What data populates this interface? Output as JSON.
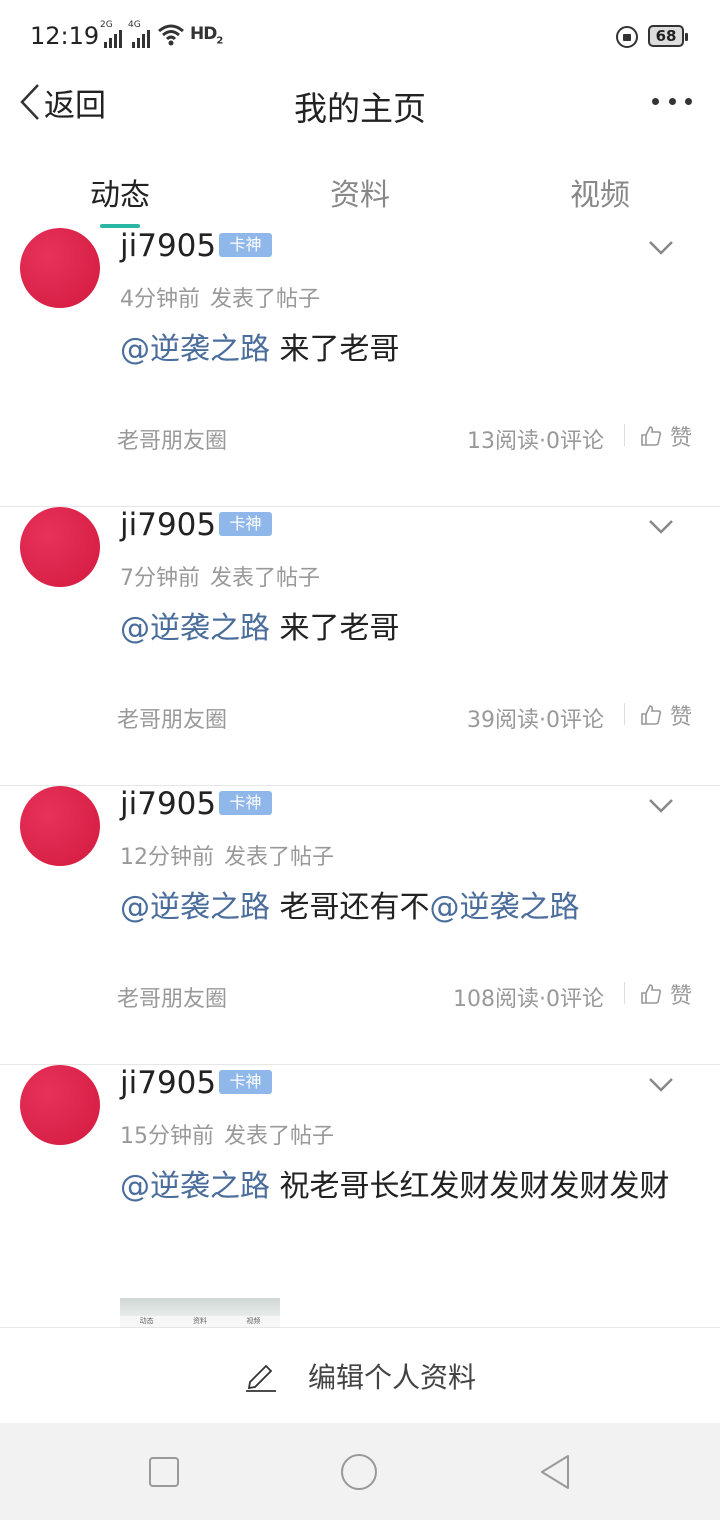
{
  "status": {
    "time": "12:19",
    "net1": "2G",
    "net2": "4G",
    "hd": "HD",
    "hd_sub": "2",
    "battery": "68"
  },
  "nav": {
    "back_label": "返回",
    "title": "我的主页"
  },
  "tabs": [
    {
      "label": "动态"
    },
    {
      "label": "资料"
    },
    {
      "label": "视频"
    }
  ],
  "posts": [
    {
      "user": "ji7905",
      "badge": "卡神",
      "time": "4分钟前",
      "action": "发表了帖子",
      "mention": "@逆袭之路",
      "text": " 来了老哥",
      "group": "老哥朋友圈",
      "stats": "13阅读·0评论",
      "like": "赞"
    },
    {
      "user": "ji7905",
      "badge": "卡神",
      "time": "7分钟前",
      "action": "发表了帖子",
      "mention": "@逆袭之路",
      "text": " 来了老哥",
      "group": "老哥朋友圈",
      "stats": "39阅读·0评论",
      "like": "赞"
    },
    {
      "user": "ji7905",
      "badge": "卡神",
      "time": "12分钟前",
      "action": "发表了帖子",
      "mention": "@逆袭之路",
      "text": " 老哥还有不",
      "mention2": "@逆袭之路",
      "group": "老哥朋友圈",
      "stats": "108阅读·0评论",
      "like": "赞"
    },
    {
      "user": "ji7905",
      "badge": "卡神",
      "time": "15分钟前",
      "action": "发表了帖子",
      "mention": "@逆袭之路",
      "text": " 祝老哥长红发财发财发财发财"
    }
  ],
  "thumbnail_tabs": [
    "动态",
    "资料",
    "视频"
  ],
  "edit_profile": "编辑个人资料",
  "colors": {
    "accent": "#2ab7a6",
    "avatar": "#dc2347",
    "badge": "#8fb7ea",
    "mention": "#4a6d9b"
  },
  "icons": {
    "back": "chevron-left-icon",
    "more": "more-dots-icon",
    "chevron": "chevron-down-icon",
    "like": "thumbs-up-icon",
    "edit": "pencil-icon"
  }
}
